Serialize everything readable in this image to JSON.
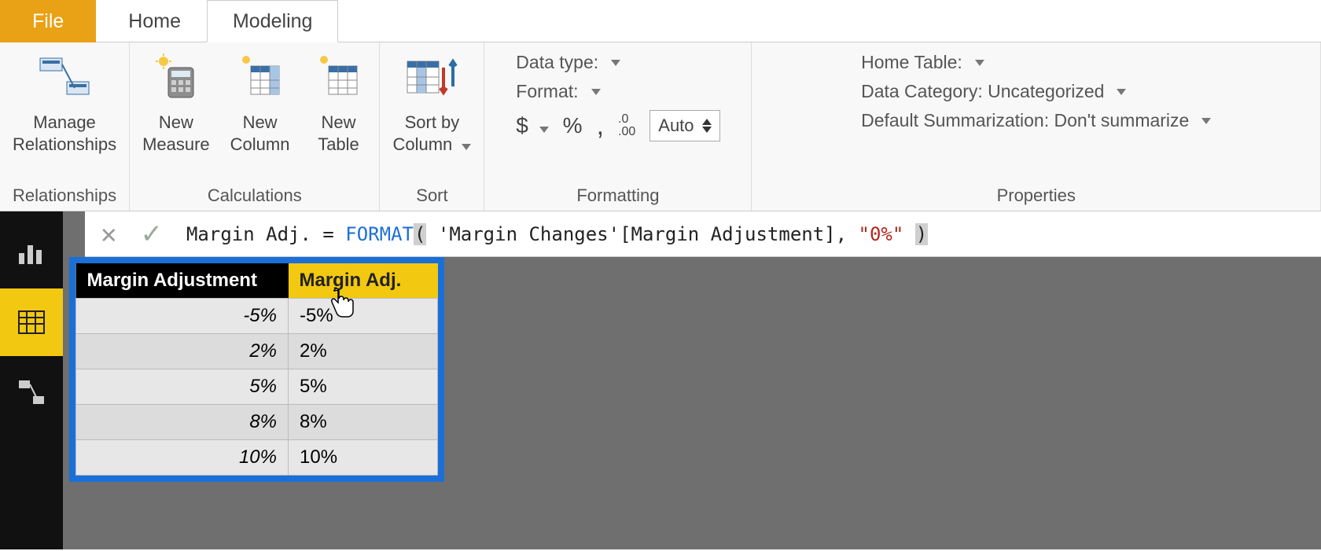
{
  "tabs": {
    "file": "File",
    "home": "Home",
    "modeling": "Modeling"
  },
  "ribbon": {
    "relationships_group": "Relationships",
    "manage_relationships": "Manage\nRelationships",
    "calculations_group": "Calculations",
    "new_measure": "New\nMeasure",
    "new_column": "New\nColumn",
    "new_table": "New\nTable",
    "sort_group": "Sort",
    "sort_by_column": "Sort by\nColumn",
    "formatting_group": "Formatting",
    "properties_group": "Properties",
    "data_type": "Data type:",
    "format": "Format:",
    "dollar": "$",
    "percent": "%",
    "comma": ",",
    "decimals_icon": ".00",
    "auto": "Auto",
    "home_table": "Home Table:",
    "data_category": "Data Category: Uncategorized",
    "default_summarization": "Default Summarization: Don't summarize"
  },
  "formula": {
    "prefix": "Margin Adj. = ",
    "func": "FORMAT",
    "open": "(",
    "args": " 'Margin Changes'[Margin Adjustment], ",
    "str": "\"0%\"",
    "close_sp": " ",
    "close": ")"
  },
  "table": {
    "col1": "Margin Adjustment",
    "col2": "Margin Adj.",
    "rows": [
      {
        "a": "-5%",
        "b": "-5%"
      },
      {
        "a": "2%",
        "b": "2%"
      },
      {
        "a": "5%",
        "b": "5%"
      },
      {
        "a": "8%",
        "b": "8%"
      },
      {
        "a": "10%",
        "b": "10%"
      }
    ]
  }
}
